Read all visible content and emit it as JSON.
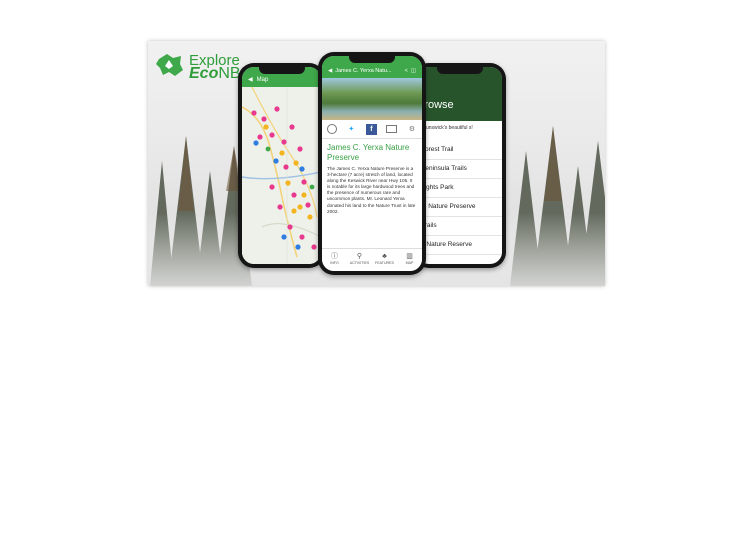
{
  "logo": {
    "line1": "Explore",
    "line2_eco": "Eco",
    "line2_nb": "NB"
  },
  "map_screen": {
    "title": "Map"
  },
  "detail_screen": {
    "header_title": "James C. Yerxa Natu...",
    "title": "James C. Yerxa Nature Preserve",
    "body": "The James C. Yerxa Nature Preserve is a 3-hectare (7 acre) stretch of land, located along the Keswick River near Hwy 105. It is notable for its large hardwood trees and the presence of numerous rare and uncommon plants. Mr. Leonard Yerxa donated his land to the Nature Trust in late 2002.",
    "nav": [
      {
        "label": "INFO",
        "icon": "info-icon",
        "glyph": "ⓘ"
      },
      {
        "label": "ACTIVITIES",
        "icon": "bicycle-icon",
        "glyph": "⚲"
      },
      {
        "label": "FEATURES",
        "icon": "tree-icon",
        "glyph": "♣"
      },
      {
        "label": "MAP",
        "icon": "map-icon",
        "glyph": "▥"
      }
    ]
  },
  "browse_screen": {
    "title": "Browse",
    "intro": "Brunswick's beautiful s!",
    "items": [
      "Forest Trail",
      "Peninsula Trails",
      "eights Park",
      "te Nature Preserve",
      "Trails",
      "e Nature Reserve"
    ]
  },
  "colors": {
    "brand_green": "#3fa84a",
    "dark_green": "#28542c",
    "title_green": "#39a046"
  }
}
